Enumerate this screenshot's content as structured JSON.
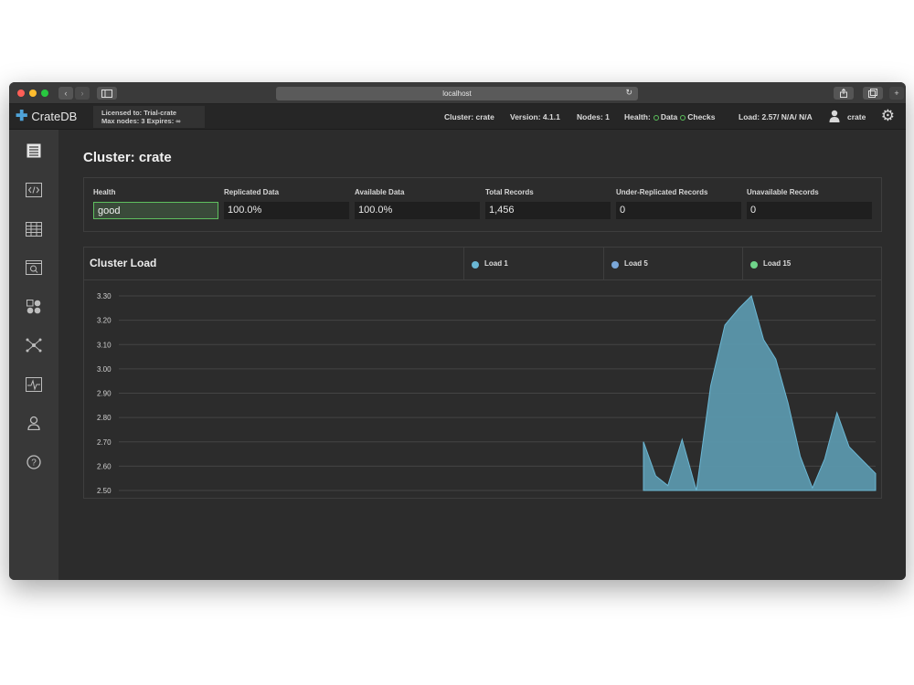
{
  "browser": {
    "address": "localhost"
  },
  "header": {
    "logo_text": "CrateDB",
    "license_line1": "Licensed to: Trial-crate",
    "license_line2": "Max nodes: 3 Expires: ∞",
    "cluster": "Cluster: crate",
    "version": "Version: 4.1.1",
    "nodes": "Nodes: 1",
    "health_label": "Health:",
    "health_data": "Data",
    "health_checks": "Checks",
    "load": "Load: 2.57/ N/A/ N/A",
    "user": "crate"
  },
  "sidebar": {
    "items": [
      {
        "name": "overview",
        "icon": "list-icon"
      },
      {
        "name": "console",
        "icon": "code-icon"
      },
      {
        "name": "tables",
        "icon": "table-icon"
      },
      {
        "name": "views",
        "icon": "search-window-icon"
      },
      {
        "name": "shards",
        "icon": "shards-icon"
      },
      {
        "name": "cluster",
        "icon": "network-icon"
      },
      {
        "name": "monitoring",
        "icon": "monitor-icon"
      },
      {
        "name": "users",
        "icon": "user-icon"
      },
      {
        "name": "help",
        "icon": "help-icon"
      }
    ]
  },
  "main": {
    "title": "Cluster: crate",
    "stats": [
      {
        "label": "Health",
        "value": "good"
      },
      {
        "label": "Replicated Data",
        "value": "100.0%"
      },
      {
        "label": "Available Data",
        "value": "100.0%"
      },
      {
        "label": "Total Records",
        "value": "1,456"
      },
      {
        "label": "Under-Replicated Records",
        "value": "0"
      },
      {
        "label": "Unavailable Records",
        "value": "0"
      }
    ],
    "load_title": "Cluster Load",
    "legend": [
      {
        "label": "Load 1",
        "color": "#6bb7d4"
      },
      {
        "label": "Load 5",
        "color": "#7ba7d8"
      },
      {
        "label": "Load 15",
        "color": "#6fd48a"
      }
    ]
  },
  "colors": {
    "accent": "#4fa3d9",
    "area_fill": "#5b97ac",
    "health_ok": "#5fbf5f"
  },
  "chart_data": {
    "type": "area",
    "series": [
      {
        "name": "Load 1",
        "points": [
          [
            0.0,
            2.7
          ],
          [
            0.06,
            2.56
          ],
          [
            0.12,
            2.52
          ],
          [
            0.19,
            2.71
          ],
          [
            0.26,
            2.5
          ],
          [
            0.33,
            2.93
          ],
          [
            0.4,
            3.18
          ],
          [
            0.47,
            3.25
          ],
          [
            0.53,
            3.3
          ],
          [
            0.59,
            3.12
          ],
          [
            0.65,
            3.04
          ],
          [
            0.71,
            2.86
          ],
          [
            0.77,
            2.64
          ],
          [
            0.83,
            2.51
          ],
          [
            0.89,
            2.63
          ],
          [
            0.95,
            2.82
          ],
          [
            1.01,
            2.68
          ],
          [
            1.08,
            2.62
          ],
          [
            1.14,
            2.57
          ]
        ]
      }
    ],
    "ylim": [
      2.5,
      3.3
    ],
    "yticks": [
      "3.30",
      "3.20",
      "3.10",
      "3.00",
      "2.90",
      "2.80",
      "2.70",
      "2.60",
      "2.50"
    ],
    "grid": true
  }
}
